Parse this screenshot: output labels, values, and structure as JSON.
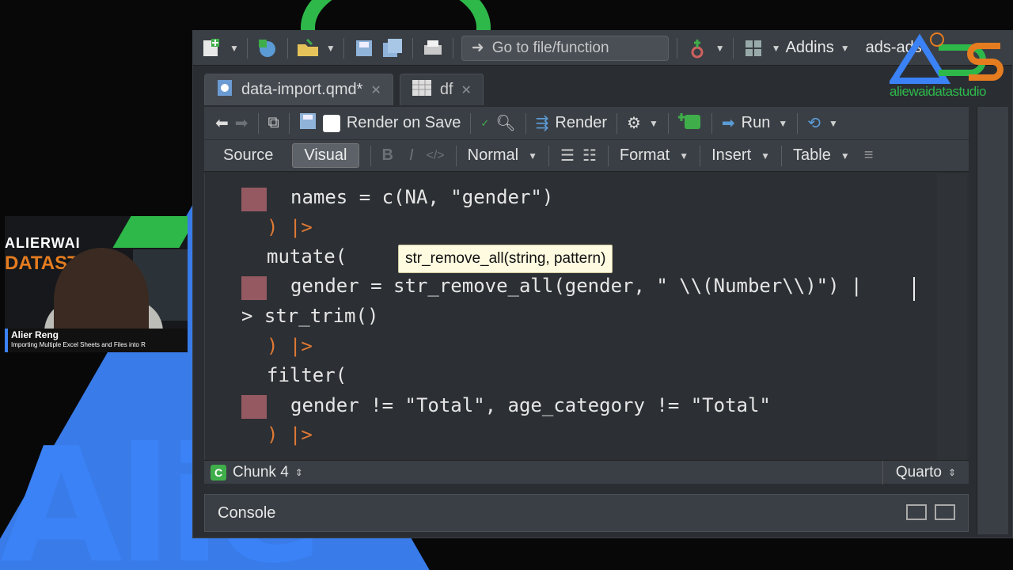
{
  "toolbar": {
    "goto_placeholder": "Go to file/function",
    "addins_label": "Addins",
    "project_label": "ads-ads"
  },
  "tabs": [
    {
      "label": "data-import.qmd*",
      "active": true
    },
    {
      "label": "df",
      "active": false
    }
  ],
  "editor_toolbar": {
    "render_on_save": "Render on Save",
    "render": "Render",
    "run": "Run"
  },
  "format_toolbar": {
    "source": "Source",
    "visual": "Visual",
    "bold": "B",
    "italic": "I",
    "code": "</>",
    "style": "Normal",
    "format": "Format",
    "insert": "Insert",
    "table": "Table"
  },
  "code_lines": [
    "names = c(NA, \"gender\")",
    ") |>",
    "mutate(",
    "gender = str_remove_all(gender, \" \\\\(Number\\\\)\") |",
    "> str_trim()",
    ") |>",
    "filter(",
    "gender != \"Total\", age_category != \"Total\"",
    ") |>"
  ],
  "tooltip": "str_remove_all(string, pattern)",
  "status": {
    "chunk": "Chunk 4",
    "mode": "Quarto"
  },
  "console": {
    "label": "Console"
  },
  "presenter": {
    "name": "Alier Reng",
    "subtitle": "Importing Multiple Excel Sheets and Files into R",
    "logo_line1": "ALIERWAI",
    "logo_line2": "DATAST"
  },
  "brand": {
    "watermark": "aliewaidatastudio",
    "background_text": "Alie"
  },
  "colors": {
    "accent_blue": "#3b82f6",
    "accent_green": "#2fb84a",
    "accent_orange": "#e57c20",
    "marker": "#a8606b"
  }
}
